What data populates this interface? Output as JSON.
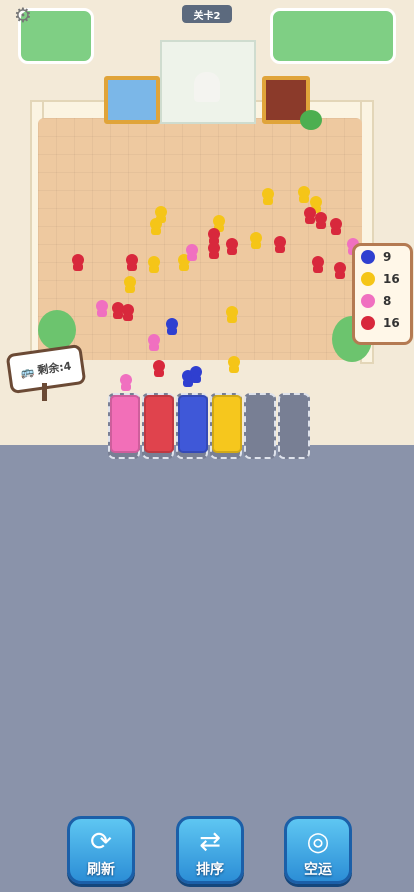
{
  "header": {
    "level_label": "关卡2"
  },
  "legend": [
    {
      "color": "#2f3fd0",
      "count": "9"
    },
    {
      "color": "#f5c518",
      "count": "16"
    },
    {
      "color": "#f070c0",
      "count": "8"
    },
    {
      "color": "#d8283c",
      "count": "16"
    }
  ],
  "sign": {
    "label": "剩余:4"
  },
  "trucks": [
    {
      "color": "#f26fb8",
      "state": "loaded"
    },
    {
      "color": "#e0434d",
      "state": "loaded"
    },
    {
      "color": "#3f58d8",
      "state": "loaded"
    },
    {
      "color": "#f6c71d",
      "state": "loaded"
    },
    {
      "color": "",
      "state": "empty"
    },
    {
      "color": "",
      "state": "empty"
    }
  ],
  "buttons": [
    {
      "label": "刷新",
      "icon": "refresh-icon"
    },
    {
      "label": "排序",
      "icon": "sort-icon"
    },
    {
      "label": "空运",
      "icon": "airlift-icon"
    }
  ],
  "icons": {
    "settings": "gear-icon"
  }
}
